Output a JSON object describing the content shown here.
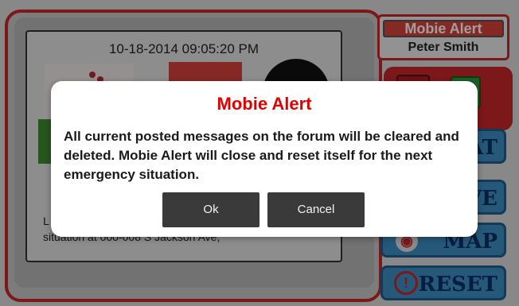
{
  "post": {
    "timestamp": "10-18-2014 09:05:20 PM",
    "text_line1": "L",
    "text_line2": "situation at 000-008 S Jackson Ave,"
  },
  "brand": {
    "title": "Mobie Alert",
    "user": "Peter Smith"
  },
  "side_buttons": {
    "chat": "AT",
    "save": "VE",
    "map": "MAP",
    "reset": "RESET"
  },
  "dialog": {
    "title": "Mobie Alert",
    "message": "All current posted messages on the forum will be cleared and deleted. Mobie Alert will close and reset itself for the next emergency situation.",
    "ok_label": "Ok",
    "cancel_label": "Cancel"
  },
  "colors": {
    "accent_red": "#c8262b",
    "dialog_title": "#e00000",
    "button_dark": "#3a3a3a",
    "side_button_blue": "#3e8ec4"
  }
}
